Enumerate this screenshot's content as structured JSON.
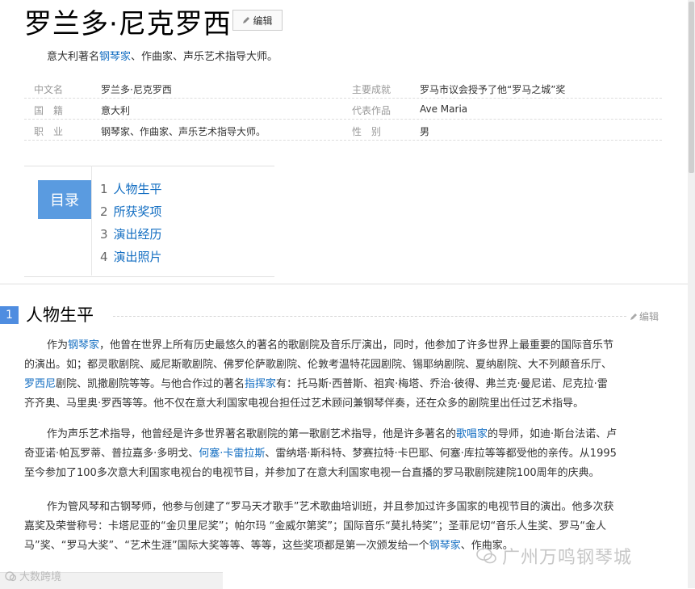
{
  "page": {
    "title": "罗兰多·尼克罗西",
    "edit_label": "编辑",
    "intro_pre": "意大利著名",
    "intro_link": "钢琴家",
    "intro_post": "、作曲家、声乐艺术指导大师。"
  },
  "basic_info": [
    {
      "k1": "中文名",
      "v1": "罗兰多·尼克罗西",
      "k2": "主要成就",
      "v2": "罗马市议会授予了他“罗马之城”奖"
    },
    {
      "k1": "国　籍",
      "v1": "意大利",
      "k2": "代表作品",
      "v2": "Ave Maria"
    },
    {
      "k1": "职　业",
      "v1": "钢琴家、作曲家、声乐艺术指导大师。",
      "k2": "性　别",
      "v2": "男"
    }
  ],
  "catalog": {
    "label": "目录",
    "items": [
      {
        "num": "1",
        "label": "人物生平"
      },
      {
        "num": "2",
        "label": "所获奖项"
      },
      {
        "num": "3",
        "label": "演出经历"
      },
      {
        "num": "4",
        "label": "演出照片"
      }
    ]
  },
  "section": {
    "number": "1",
    "title": "人物生平",
    "edit_label": "编辑"
  },
  "paragraphs": {
    "p1": {
      "l1a": "作为",
      "l1link": "钢琴家",
      "l1b": "，他曾在世界上所有历史最悠久的著名的歌剧院及音乐厅演出，同时，他参加了许多世界上最重要的国际音乐节",
      "l2": "的演出。如；都灵歌剧院、威尼斯歌剧院、佛罗伦萨歌剧院、伦敦考温特花园剧院、锡耶纳剧院、夏纳剧院、大不列颠音乐厅、",
      "l3link": "罗西尼",
      "l3a": "剧院、凯撒剧院等等。与他合作过的著名",
      "l3link2": "指挥家",
      "l3b": "有：托马斯·西普斯、祖宾·梅塔、乔治·彼得、弗兰克·曼尼诺、尼克拉·雷",
      "l4": "齐齐奥、马里奥·罗西等等。他不仅在意大利国家电视台担任过艺术顾问兼钢琴伴奏，还在众多的剧院里出任过艺术指导。"
    },
    "p2": {
      "l1a": "作为声乐艺术指导，他曾经是许多世界著名歌剧院的第一歌剧艺术指导，他是许多著名的",
      "l1link": "歌唱家",
      "l1b": "的导师，如迪·斯台法诺、卢",
      "l2a": "奇亚诺·帕瓦罗蒂、普拉嘉多·多明戈、",
      "l2link": "何塞·卡雷拉斯",
      "l2b": "、雷纳塔·斯科特、梦赛拉特·卡巴耶、何塞·库拉等等都受他的亲传。从1995",
      "l3": "至今参加了100多次意大利国家电视台的电视节目，并参加了在意大利国家电视一台直播的罗马歌剧院建院100周年的庆典。"
    },
    "p3": {
      "l1": "作为管风琴和古钢琴师，他参与创建了“罗马天才歌手”艺术歌曲培训班，并且参加过许多国家的电视节目的演出。他多次获",
      "l2": "嘉奖及荣誉称号：卡塔尼亚的“金贝里尼奖”；帕尔玛 “金威尔第奖”；国际音乐“莫扎特奖”；圣菲尼切“音乐人生奖、罗马“金人",
      "l3a": "马”奖、“罗马大奖”、“艺术生涯”国际大奖等等、等等，这些奖项都是第一次颁发给一个",
      "l3link": "钢琴家",
      "l3b": "、作曲家。"
    }
  },
  "watermarks": {
    "right": "广州万鸣钢琴城",
    "left": "大数跨境"
  },
  "colors": {
    "link": "#136ec2",
    "catalog_bg": "#5a9be0",
    "section_number_bg": "#4f8de0"
  }
}
